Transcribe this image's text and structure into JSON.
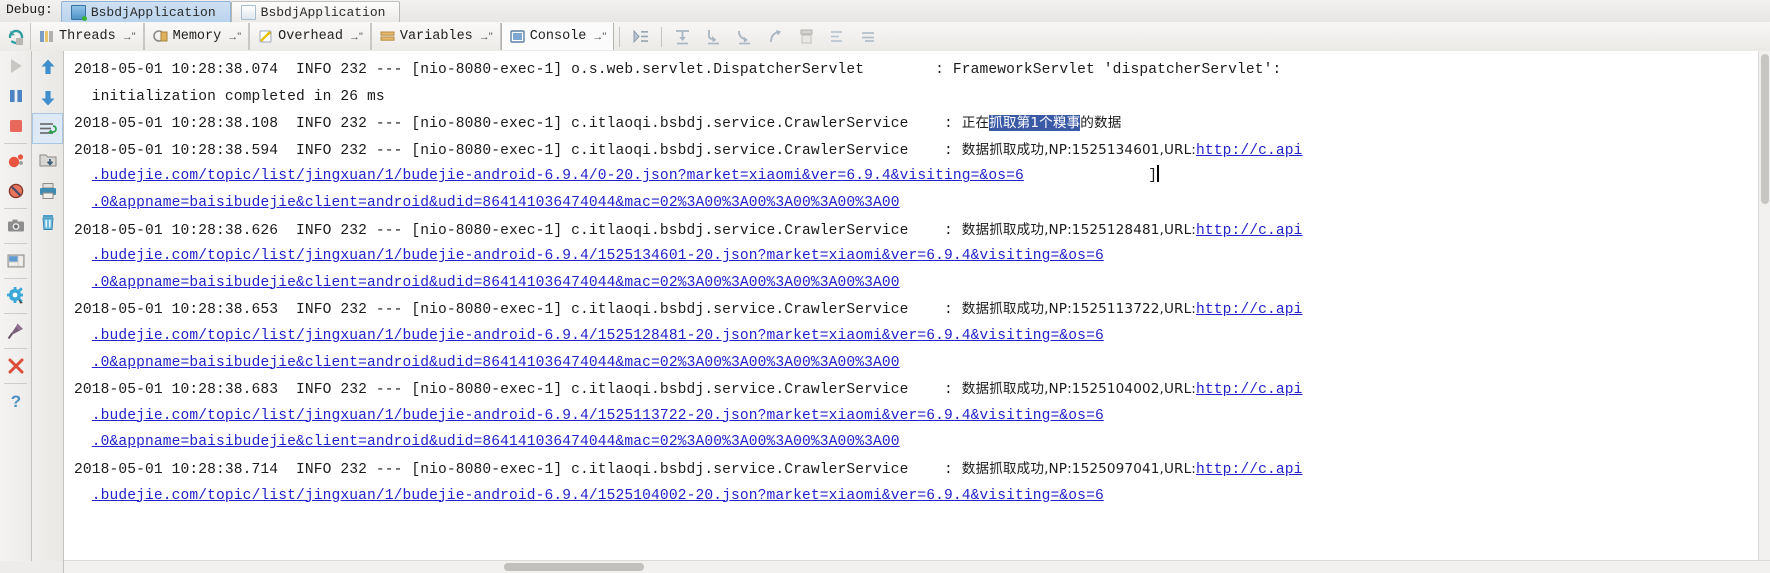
{
  "window": {
    "debug_label": "Debug:",
    "tabs": [
      {
        "label": "BsbdjApplication",
        "icon": "debug-session-icon",
        "active": true
      },
      {
        "label": "BsbdjApplication",
        "icon": "run-session-icon",
        "active": false
      }
    ]
  },
  "toolbar": {
    "rerun_icon": "rerun-icon",
    "tabs": [
      {
        "label": "Threads",
        "icon": "threads-icon",
        "pin": "→\"",
        "active": false
      },
      {
        "label": "Memory",
        "icon": "memory-icon",
        "pin": "→\"",
        "active": false
      },
      {
        "label": "Overhead",
        "icon": "overhead-icon",
        "pin": "→\"",
        "active": false
      },
      {
        "label": "Variables",
        "icon": "variables-icon",
        "pin": "→\"",
        "active": false
      },
      {
        "label": "Console",
        "icon": "console-icon",
        "pin": "→\"",
        "active": true
      }
    ],
    "actions": [
      "show-execution-point-icon",
      "step-over-icon",
      "step-into-icon",
      "force-step-into-icon",
      "step-out-icon",
      "drop-frame-icon",
      "run-to-cursor-icon",
      "evaluate-expression-icon"
    ]
  },
  "left_rail": {
    "items": [
      "resume-program-icon",
      "pause-program-icon",
      "stop-icon",
      "view-breakpoints-icon",
      "mute-breakpoints-icon",
      "camera-icon",
      "layout-icon",
      "settings-icon",
      "pin-tab-icon",
      "close-icon",
      "help-icon"
    ]
  },
  "console_rail": {
    "items": [
      "scroll-up-icon",
      "scroll-down-icon",
      "soft-wrap-icon",
      "open-in-editor-icon",
      "print-icon",
      "clear-all-icon"
    ]
  },
  "console": {
    "lines": [
      {
        "type": "log",
        "segments": [
          {
            "t": "2018-05-01 10:28:38.074  INFO 232 --- [nio-8080-exec-1] o.s.web.servlet.DispatcherServlet        : FrameworkServlet 'dispatcherServlet':"
          }
        ]
      },
      {
        "type": "log",
        "segments": [
          {
            "t": "  initialization completed in 26 ms"
          }
        ]
      },
      {
        "type": "log",
        "segments": [
          {
            "t": "2018-05-01 10:28:38.108  INFO 232 --- [nio-8080-exec-1] c.itlaoqi.bsbdj.service.CrawlerService    : "
          },
          {
            "t": "正在",
            "cn": true
          },
          {
            "t": "抓取第1个糗事",
            "cn": true,
            "sel": true
          },
          {
            "t": "的数据",
            "cn": true
          }
        ]
      },
      {
        "type": "log",
        "segments": [
          {
            "t": "2018-05-01 10:28:38.594  INFO 232 --- [nio-8080-exec-1] c.itlaoqi.bsbdj.service.CrawlerService    : "
          },
          {
            "t": "数据抓取成功,NP:1525134601,URL:",
            "cn": true
          },
          {
            "t": "http://c.api",
            "url": true
          }
        ]
      },
      {
        "type": "log",
        "segments": [
          {
            "t": "  "
          },
          {
            "t": ".budejie.com/topic/list/jingxuan/1/budejie-android-6.9.4/0-20.json?market=xiaomi&ver=6.9.4&visiting=&os=6",
            "url": true
          },
          {
            "t": "              ]"
          }
        ]
      },
      {
        "type": "log",
        "segments": [
          {
            "t": "  "
          },
          {
            "t": ".0&appname=baisibudejie&client=android&udid=864141036474044&mac=02%3A00%3A00%3A00%3A00%3A00",
            "url": true
          }
        ]
      },
      {
        "type": "log",
        "segments": [
          {
            "t": "2018-05-01 10:28:38.626  INFO 232 --- [nio-8080-exec-1] c.itlaoqi.bsbdj.service.CrawlerService    : "
          },
          {
            "t": "数据抓取成功,NP:1525128481,URL:",
            "cn": true
          },
          {
            "t": "http://c.api",
            "url": true
          }
        ]
      },
      {
        "type": "log",
        "segments": [
          {
            "t": "  "
          },
          {
            "t": ".budejie.com/topic/list/jingxuan/1/budejie-android-6.9.4/1525134601-20.json?market=xiaomi&ver=6.9.4&visiting=&os=6",
            "url": true
          }
        ]
      },
      {
        "type": "log",
        "segments": [
          {
            "t": "  "
          },
          {
            "t": ".0&appname=baisibudejie&client=android&udid=864141036474044&mac=02%3A00%3A00%3A00%3A00%3A00",
            "url": true
          }
        ]
      },
      {
        "type": "log",
        "segments": [
          {
            "t": "2018-05-01 10:28:38.653  INFO 232 --- [nio-8080-exec-1] c.itlaoqi.bsbdj.service.CrawlerService    : "
          },
          {
            "t": "数据抓取成功,NP:1525113722,URL:",
            "cn": true
          },
          {
            "t": "http://c.api",
            "url": true
          }
        ]
      },
      {
        "type": "log",
        "segments": [
          {
            "t": "  "
          },
          {
            "t": ".budejie.com/topic/list/jingxuan/1/budejie-android-6.9.4/1525128481-20.json?market=xiaomi&ver=6.9.4&visiting=&os=6",
            "url": true
          }
        ]
      },
      {
        "type": "log",
        "segments": [
          {
            "t": "  "
          },
          {
            "t": ".0&appname=baisibudejie&client=android&udid=864141036474044&mac=02%3A00%3A00%3A00%3A00%3A00",
            "url": true
          }
        ]
      },
      {
        "type": "log",
        "segments": [
          {
            "t": "2018-05-01 10:28:38.683  INFO 232 --- [nio-8080-exec-1] c.itlaoqi.bsbdj.service.CrawlerService    : "
          },
          {
            "t": "数据抓取成功,NP:1525104002,URL:",
            "cn": true
          },
          {
            "t": "http://c.api",
            "url": true
          }
        ]
      },
      {
        "type": "log",
        "segments": [
          {
            "t": "  "
          },
          {
            "t": ".budejie.com/topic/list/jingxuan/1/budejie-android-6.9.4/1525113722-20.json?market=xiaomi&ver=6.9.4&visiting=&os=6",
            "url": true
          }
        ]
      },
      {
        "type": "log",
        "segments": [
          {
            "t": "  "
          },
          {
            "t": ".0&appname=baisibudejie&client=android&udid=864141036474044&mac=02%3A00%3A00%3A00%3A00%3A00",
            "url": true
          }
        ]
      },
      {
        "type": "log",
        "segments": [
          {
            "t": "2018-05-01 10:28:38.714  INFO 232 --- [nio-8080-exec-1] c.itlaoqi.bsbdj.service.CrawlerService    : "
          },
          {
            "t": "数据抓取成功,NP:1525097041,URL:",
            "cn": true
          },
          {
            "t": "http://c.api",
            "url": true
          }
        ]
      },
      {
        "type": "log",
        "segments": [
          {
            "t": "  "
          },
          {
            "t": ".budejie.com/topic/list/jingxuan/1/budejie-android-6.9.4/1525104002-20.json?market=xiaomi&ver=6.9.4&visiting=&os=6",
            "url": true
          }
        ]
      }
    ]
  },
  "colors": {
    "url_link": "#2222cc",
    "selection": "#3b5aa6",
    "tab_active": "#b9d3ee",
    "console_bg": "#ffffff"
  }
}
